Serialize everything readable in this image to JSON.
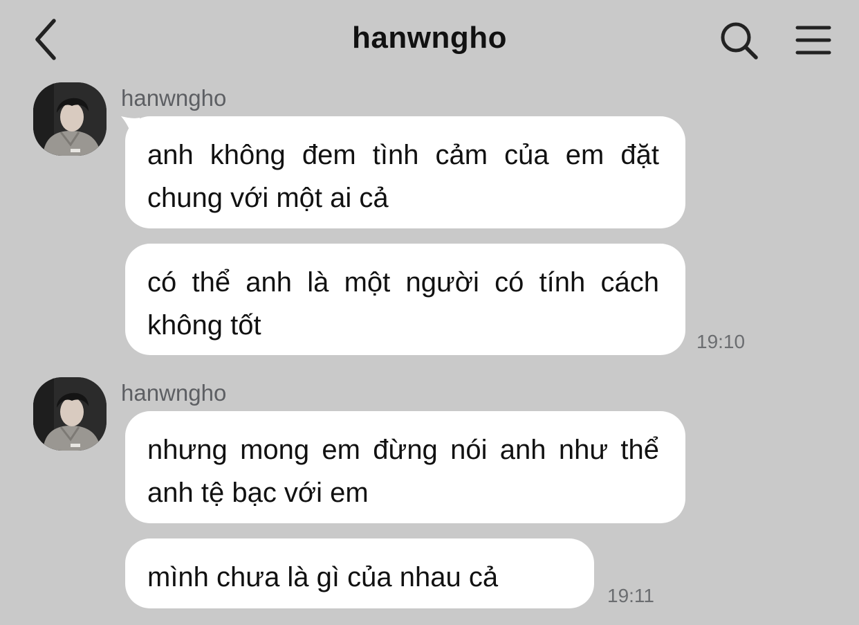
{
  "header": {
    "title": "hanwngho",
    "back_icon": "chevron-left-icon",
    "search_icon": "search-icon",
    "menu_icon": "hamburger-menu-icon"
  },
  "colors": {
    "background": "#c9c9c9",
    "bubble": "#ffffff",
    "text": "#111111",
    "meta_text": "#6b6d70"
  },
  "groups": [
    {
      "sender": "hanwngho",
      "messages": [
        "anh không đem tình cảm của em đặt chung với một ai cả",
        "có thể anh là một người có tính cách không tốt"
      ],
      "time": "19:10"
    },
    {
      "sender": "hanwngho",
      "messages": [
        "nhưng mong em đừng nói anh như thể anh tệ bạc với em",
        "mình chưa là gì của nhau cả"
      ],
      "time": "19:11"
    }
  ]
}
